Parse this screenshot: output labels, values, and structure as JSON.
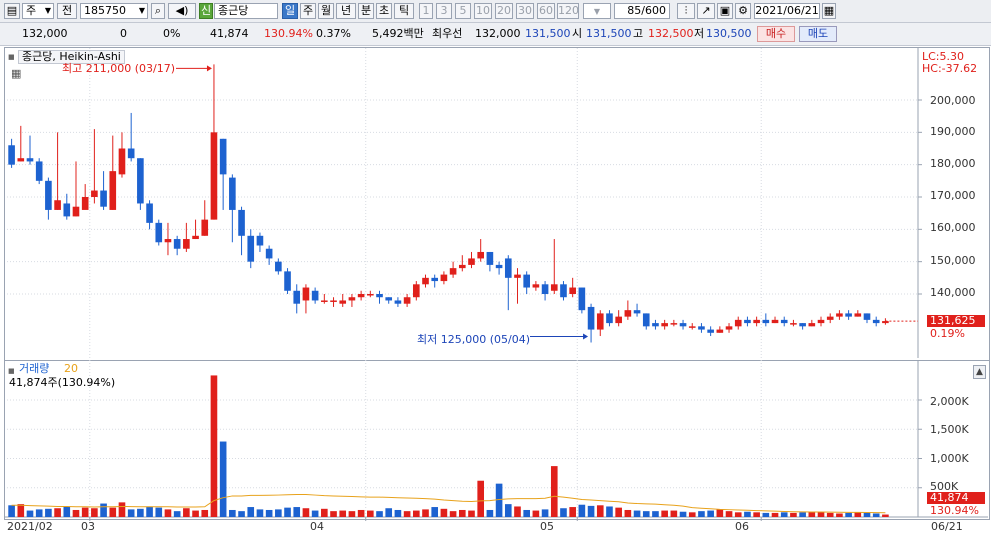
{
  "toolbar": {
    "market": "주",
    "prev_label": "전",
    "code": "185750",
    "sin_badge": "신",
    "stock_name": "종근당",
    "periods": [
      "일",
      "주",
      "월",
      "년",
      "분",
      "초",
      "틱"
    ],
    "active_period": "일",
    "minute_options": [
      "1",
      "3",
      "5",
      "10",
      "20",
      "30",
      "60",
      "120"
    ],
    "count": "85/600",
    "date": "2021/06/21"
  },
  "quote": {
    "price": "132,000",
    "change": "0",
    "change_pct": "0%",
    "volume": "41,874",
    "volume_ratio": "130.94%",
    "turnover": "0.37%",
    "amount": "5,492백만",
    "best_label": "최우선",
    "best_ask": "132,000",
    "best_bid": "131,500",
    "open_label": "시",
    "open": "131,500",
    "high_label": "고",
    "high": "132,500",
    "low_label": "저",
    "low": "130,500",
    "buy_label": "매수",
    "sell_label": "매도"
  },
  "price_panel": {
    "title": "종근당, Heikin-Ashi",
    "lc": "LC:5.30",
    "hc": "HC:-37.62",
    "max_note": "최고 211,000 (03/17)",
    "min_note": "최저 125,000 (05/04)",
    "current_price": "131,625",
    "current_pct": "0.19%",
    "y_ticks": [
      "200,000",
      "190,000",
      "180,000",
      "170,000",
      "160,000",
      "150,000",
      "140,000"
    ]
  },
  "volume_panel": {
    "title": "거래량",
    "period": "20",
    "summary": "41,874주(130.94%)",
    "current": "41,874",
    "current_pct": "130.94%",
    "y_ticks": [
      "2,000K",
      "1,500K",
      "1,000K",
      "500K"
    ]
  },
  "x_ticks": [
    "2021/02",
    "03",
    "04",
    "05",
    "06",
    "06/21"
  ],
  "colors": {
    "up": "#e0201b",
    "down": "#1d62d0",
    "ma": "#e8a21b",
    "accent": "#3b78c8"
  },
  "chart_data": {
    "type": "candlestick",
    "title": "종근당, Heikin-Ashi",
    "y_ticks": [
      140000,
      150000,
      160000,
      170000,
      180000,
      190000,
      200000
    ],
    "max_annotation": {
      "value": 211000,
      "date": "03/17"
    },
    "min_annotation": {
      "value": 125000,
      "date": "05/04"
    },
    "current": 131625,
    "candles": [
      [
        186000,
        180000,
        188000,
        179000
      ],
      [
        181000,
        182000,
        192000,
        181000
      ],
      [
        182000,
        181000,
        189000,
        180000
      ],
      [
        181000,
        175000,
        182000,
        174000
      ],
      [
        175000,
        166000,
        176000,
        163000
      ],
      [
        166000,
        169000,
        190000,
        166000
      ],
      [
        168000,
        164000,
        171000,
        163000
      ],
      [
        164000,
        167000,
        181000,
        164000
      ],
      [
        166000,
        170000,
        174000,
        168000
      ],
      [
        170000,
        172000,
        191000,
        168000
      ],
      [
        172000,
        167000,
        178000,
        166000
      ],
      [
        166000,
        178000,
        189000,
        166000
      ],
      [
        177000,
        185000,
        190000,
        176000
      ],
      [
        185000,
        182000,
        196000,
        181000
      ],
      [
        182000,
        168000,
        182000,
        166000
      ],
      [
        168000,
        162000,
        169000,
        160000
      ],
      [
        162000,
        156000,
        163000,
        155000
      ],
      [
        156000,
        157000,
        162000,
        152000
      ],
      [
        157000,
        154000,
        158000,
        152000
      ],
      [
        154000,
        157000,
        162000,
        153000
      ],
      [
        157000,
        158000,
        163000,
        157000
      ],
      [
        158000,
        163000,
        169000,
        158000
      ],
      [
        163000,
        190000,
        211000,
        163000
      ],
      [
        188000,
        177000,
        188000,
        166000
      ],
      [
        176000,
        166000,
        177000,
        156000
      ],
      [
        166000,
        158000,
        167000,
        152000
      ],
      [
        158000,
        150000,
        160000,
        148000
      ],
      [
        158000,
        155000,
        159000,
        153000
      ],
      [
        154000,
        151000,
        155000,
        149000
      ],
      [
        150000,
        147000,
        151000,
        146000
      ],
      [
        147000,
        141000,
        148000,
        140000
      ],
      [
        141000,
        137000,
        143000,
        134000
      ],
      [
        138000,
        142000,
        143000,
        134000
      ],
      [
        141000,
        138000,
        142000,
        137000
      ],
      [
        138000,
        138000,
        140000,
        137000
      ],
      [
        138000,
        138000,
        139000,
        136000
      ],
      [
        137000,
        138000,
        140000,
        136000
      ],
      [
        138000,
        139000,
        140000,
        136000
      ],
      [
        139000,
        140000,
        141000,
        138000
      ],
      [
        140000,
        140000,
        141000,
        139000
      ],
      [
        140000,
        139000,
        141000,
        137000
      ],
      [
        139000,
        138000,
        139000,
        137000
      ],
      [
        138000,
        137000,
        139000,
        136000
      ],
      [
        137000,
        139000,
        140000,
        136000
      ],
      [
        139000,
        143000,
        144000,
        138000
      ],
      [
        143000,
        145000,
        146000,
        142000
      ],
      [
        145000,
        144000,
        146000,
        142000
      ],
      [
        144000,
        146000,
        147000,
        143000
      ],
      [
        146000,
        148000,
        150000,
        145000
      ],
      [
        148000,
        149000,
        152000,
        147000
      ],
      [
        149000,
        151000,
        153000,
        148000
      ],
      [
        151000,
        153000,
        157000,
        150000
      ],
      [
        153000,
        149000,
        153000,
        147000
      ],
      [
        149000,
        148000,
        150000,
        146000
      ],
      [
        151000,
        145000,
        152000,
        135000
      ],
      [
        145000,
        146000,
        148000,
        137000
      ],
      [
        146000,
        142000,
        147000,
        140000
      ],
      [
        142000,
        143000,
        144000,
        141000
      ],
      [
        143000,
        140000,
        144000,
        138000
      ],
      [
        141000,
        143000,
        157000,
        140000
      ],
      [
        143000,
        139000,
        144000,
        138000
      ],
      [
        140000,
        142000,
        145000,
        139000
      ],
      [
        142000,
        135000,
        142000,
        134000
      ],
      [
        136000,
        129000,
        137000,
        125000
      ],
      [
        129000,
        134000,
        135000,
        127000
      ],
      [
        134000,
        131000,
        135000,
        130000
      ],
      [
        131000,
        133000,
        135000,
        130000
      ],
      [
        133000,
        135000,
        138000,
        132000
      ],
      [
        135000,
        134000,
        137000,
        133000
      ],
      [
        134000,
        130000,
        134000,
        129000
      ],
      [
        131000,
        130000,
        132000,
        129000
      ],
      [
        130000,
        131000,
        132000,
        129000
      ],
      [
        131000,
        131000,
        132000,
        130000
      ],
      [
        131000,
        130000,
        132000,
        129000
      ],
      [
        130000,
        130000,
        131000,
        129000
      ],
      [
        130000,
        129000,
        131000,
        128000
      ],
      [
        129000,
        128000,
        130000,
        127000
      ],
      [
        128000,
        129000,
        130000,
        128000
      ],
      [
        129000,
        130000,
        131000,
        128000
      ],
      [
        130000,
        132000,
        133000,
        129000
      ],
      [
        132000,
        131000,
        133000,
        130000
      ],
      [
        131000,
        132000,
        133000,
        130000
      ],
      [
        132000,
        131000,
        134000,
        130000
      ],
      [
        131000,
        132000,
        133000,
        131000
      ],
      [
        132000,
        131000,
        133000,
        130000
      ],
      [
        131000,
        131000,
        132000,
        130000
      ],
      [
        131000,
        130000,
        131000,
        129000
      ],
      [
        130000,
        131000,
        132000,
        130000
      ],
      [
        131000,
        132000,
        133000,
        130000
      ],
      [
        132000,
        133000,
        134000,
        131000
      ],
      [
        133000,
        134000,
        135000,
        132000
      ],
      [
        134000,
        133000,
        135000,
        132000
      ],
      [
        133000,
        134000,
        135000,
        133000
      ],
      [
        134000,
        132000,
        134000,
        131000
      ],
      [
        132000,
        131000,
        133000,
        130000
      ],
      [
        131000,
        131625,
        132500,
        130500
      ]
    ],
    "volume": [
      200,
      220,
      110,
      130,
      140,
      150,
      180,
      120,
      160,
      150,
      230,
      160,
      250,
      130,
      140,
      180,
      160,
      130,
      100,
      150,
      110,
      120,
      2420,
      1290,
      120,
      100,
      170,
      130,
      120,
      130,
      160,
      170,
      150,
      110,
      140,
      100,
      110,
      100,
      120,
      110,
      100,
      150,
      120,
      100,
      110,
      130,
      170,
      140,
      100,
      120,
      110,
      620,
      120,
      570,
      220,
      180,
      120,
      110,
      130,
      870,
      150,
      170,
      210,
      190,
      200,
      180,
      160,
      120,
      110,
      100,
      100,
      110,
      110,
      90,
      80,
      100,
      110,
      130,
      100,
      80,
      90,
      80,
      70,
      70,
      80,
      70,
      80,
      90,
      80,
      70,
      60,
      70,
      80,
      70,
      60,
      42
    ],
    "volume_ma": [
      200,
      200,
      195,
      190,
      185,
      180,
      180,
      175,
      175,
      170,
      175,
      175,
      180,
      178,
      176,
      175,
      175,
      175,
      170,
      170,
      172,
      175,
      280,
      330,
      360,
      360,
      370,
      370,
      372,
      375,
      380,
      385,
      385,
      375,
      365,
      360,
      355,
      350,
      345,
      340,
      340,
      335,
      330,
      325,
      320,
      315,
      305,
      290,
      280,
      270,
      265,
      275,
      280,
      300,
      310,
      315,
      315,
      315,
      320,
      355,
      340,
      320,
      300,
      290,
      280,
      270,
      260,
      240,
      230,
      225,
      220,
      210,
      200,
      185,
      160,
      150,
      140,
      130,
      125,
      120,
      115,
      110,
      105,
      100,
      95,
      90,
      88,
      86,
      85,
      84,
      82,
      80,
      78,
      76,
      74,
      72
    ]
  }
}
